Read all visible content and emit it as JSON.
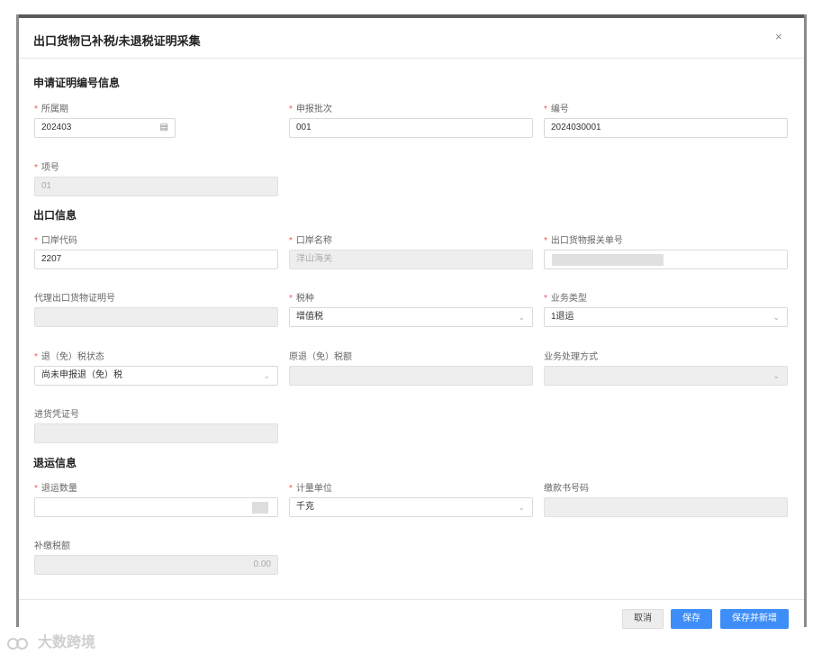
{
  "dialog": {
    "title": "出口货物已补税/未退税证明采集",
    "close_glyph": "×"
  },
  "sections": {
    "apply": "申请证明编号信息",
    "export": "出口信息",
    "return": "退运信息"
  },
  "fields": {
    "period": {
      "label": "所属期",
      "value": "202403",
      "required": true
    },
    "batch": {
      "label": "申报批次",
      "value": "001",
      "required": true
    },
    "number": {
      "label": "编号",
      "value": "2024030001",
      "required": true
    },
    "item_no": {
      "label": "项号",
      "value": "01",
      "required": true
    },
    "port_code": {
      "label": "口岸代码",
      "value": "2207",
      "required": true
    },
    "port_name": {
      "label": "口岸名称",
      "value": "洋山海关",
      "required": true
    },
    "customs_no": {
      "label": "出口货物报关单号",
      "value": "",
      "required": true
    },
    "agent_cert_no": {
      "label": "代理出口货物证明号",
      "value": ""
    },
    "tax_type": {
      "label": "税种",
      "value": "增值税",
      "required": true
    },
    "biz_type": {
      "label": "业务类型",
      "value": "1退运",
      "required": true
    },
    "refund_status": {
      "label": "退（免）税状态",
      "value": "尚未申报退（免）税",
      "required": true
    },
    "orig_refund": {
      "label": "原退（免）税额",
      "value": ""
    },
    "process_method": {
      "label": "业务处理方式",
      "value": ""
    },
    "voucher_no": {
      "label": "进货凭证号",
      "value": ""
    },
    "return_qty": {
      "label": "退运数量",
      "value": "",
      "required": true
    },
    "unit": {
      "label": "计量单位",
      "value": "千克",
      "required": true
    },
    "payment_no": {
      "label": "缴款书号码",
      "value": ""
    },
    "supp_tax": {
      "label": "补缴税额",
      "value": "0.00"
    }
  },
  "footer": {
    "cancel": "取消",
    "save": "保存",
    "save_new": "保存并新增"
  },
  "watermark": "大数跨境",
  "colors": {
    "primary": "#3f8ef7",
    "required": "#e55555"
  }
}
